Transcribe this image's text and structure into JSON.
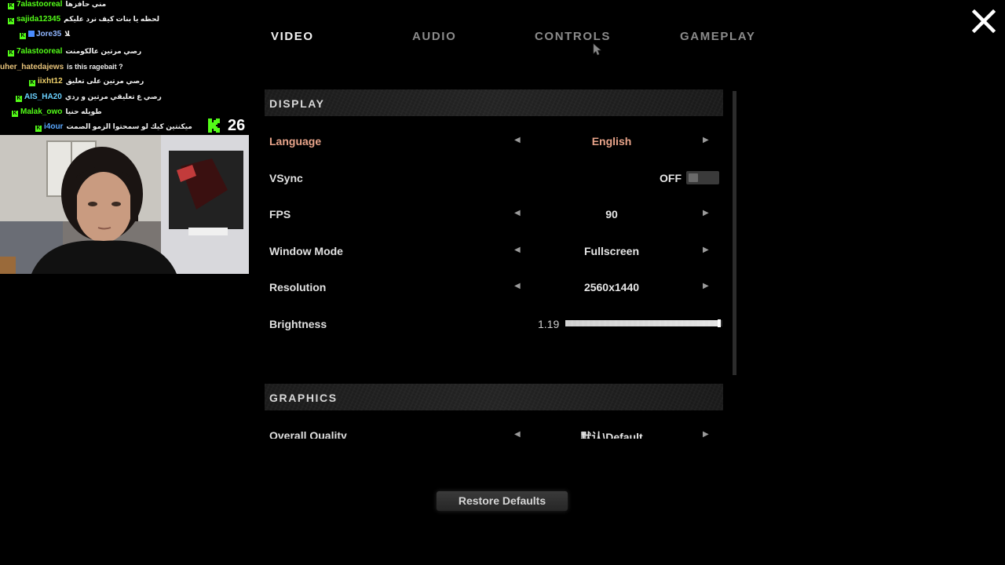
{
  "tabs": [
    {
      "label": "VIDEO",
      "active": true
    },
    {
      "label": "AUDIO",
      "active": false
    },
    {
      "label": "CONTROLS",
      "active": false
    },
    {
      "label": "GAMEPLAY",
      "active": false
    }
  ],
  "close_icon": "close-x-icon",
  "sections": {
    "display": "DISPLAY",
    "graphics": "GRAPHICS"
  },
  "settings": {
    "language": {
      "label": "Language",
      "value": "English"
    },
    "vsync": {
      "label": "VSync",
      "value": "OFF"
    },
    "fps": {
      "label": "FPS",
      "value": "90"
    },
    "window_mode": {
      "label": "Window Mode",
      "value": "Fullscreen"
    },
    "resolution": {
      "label": "Resolution",
      "value": "2560x1440"
    },
    "brightness": {
      "label": "Brightness",
      "value": "1.19",
      "fill_fraction": 0.98
    },
    "overall_quality": {
      "label": "Overall Quality",
      "value": "默认\\Default"
    }
  },
  "restore_defaults": "Restore Defaults",
  "stream_overlay": {
    "viewer_count": "26",
    "brand_color": "#53fc18",
    "chat": [
      {
        "user": "7alastooreal",
        "msg": "مني حافزها",
        "color": "#53fc18",
        "badge": "kick"
      },
      {
        "user": "sajida12345",
        "msg": "لحظه يا بنات كيف نرد عليكم",
        "color": "#53fc18",
        "badge": "kick"
      },
      {
        "user": "Jore35",
        "msg": "ﻼ",
        "color": "#8fb5ff",
        "badge": "kick+blue"
      },
      {
        "user": "7alastooreal",
        "msg": "رصي مرتين عالكومنت",
        "color": "#53fc18",
        "badge": "kick"
      },
      {
        "user": "uher_hatedajews",
        "msg": "is this ragebait ?",
        "color": "#e6c27a",
        "badge": "none"
      },
      {
        "user": "iixht12",
        "msg": "رصي مرتين على تعليق",
        "color": "#f2d36b",
        "badge": "kick"
      },
      {
        "user": "AIS_HA20",
        "msg": "رصي ع تعليقي مرتين و ردي",
        "color": "#6ad1ff",
        "badge": "kick"
      },
      {
        "user": "Malak_owo",
        "msg": "طويله حنيا",
        "color": "#53fc18",
        "badge": "kick"
      },
      {
        "user": "i4our",
        "msg": "ميكنتين كيك لو سمحتوا الزمو الصمت",
        "color": "#5aa8ff",
        "badge": "kick"
      }
    ]
  }
}
